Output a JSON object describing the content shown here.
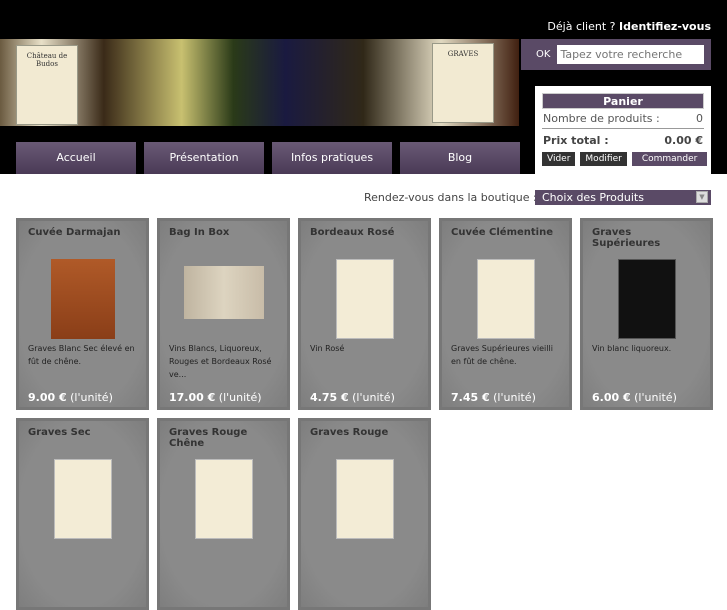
{
  "header": {
    "login_prefix": "Déjà client ?",
    "login_link": "Identifiez-vous",
    "banner_label": "Château de Budos",
    "banner_label2": "GRAVES"
  },
  "search": {
    "ok_label": "OK",
    "placeholder": "Tapez votre recherche"
  },
  "cart": {
    "title": "Panier",
    "count_label": "Nombre de produits :",
    "count": "0",
    "total_label": "Prix total :",
    "total": "0.00 €",
    "buttons": [
      "Vider",
      "Modifier",
      "Commander"
    ]
  },
  "nav": [
    "Accueil",
    "Présentation",
    "Infos pratiques",
    "Blog"
  ],
  "shop": {
    "label": "Rendez-vous dans la boutique :",
    "select_value": "Choix des Produits"
  },
  "products": [
    {
      "name": "Cuvée Darmajan",
      "desc": "Graves Blanc Sec élevé en fût de chêne.",
      "price": "9.00 €",
      "unit": "(l'unité)",
      "img": "copper"
    },
    {
      "name": "Bag In Box",
      "desc": "Vins Blancs, Liquoreux, Rouges et Bordeaux Rosé ve...",
      "price": "17.00 €",
      "unit": "(l'unité)",
      "img": "photo"
    },
    {
      "name": "Bordeaux Rosé",
      "desc": "Vin Rosé",
      "price": "4.75 €",
      "unit": "(l'unité)",
      "img": "label"
    },
    {
      "name": "Cuvée Clémentine",
      "desc": "Graves Supérieures vieilli en fût de chêne.",
      "price": "7.45 €",
      "unit": "(l'unité)",
      "img": "label"
    },
    {
      "name": "Graves Supérieures",
      "desc": "Vin blanc liquoreux.",
      "price": "6.00 €",
      "unit": "(l'unité)",
      "img": "black"
    },
    {
      "name": "Graves Sec",
      "img": "label"
    },
    {
      "name": "Graves Rouge Chêne",
      "img": "label"
    },
    {
      "name": "Graves Rouge",
      "img": "label"
    }
  ]
}
